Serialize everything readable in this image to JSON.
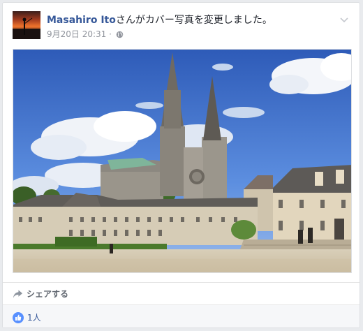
{
  "post": {
    "author_name": "Masahiro Ito",
    "action_text": "さんがカバー写真を変更しました。",
    "timestamp": "9月20日 20:31",
    "separator": "·",
    "privacy_icon": "globe-icon",
    "menu_icon": "chevron-down-icon"
  },
  "actions": {
    "share_label": "シェアする",
    "share_icon": "share-arrow-icon"
  },
  "reactions": {
    "like_icon": "thumbs-up-icon",
    "count_label": "1人"
  },
  "colors": {
    "author_link": "#365899",
    "meta_gray": "#90949c",
    "like_blue": "#5890ff",
    "background": "#e9ebee"
  }
}
